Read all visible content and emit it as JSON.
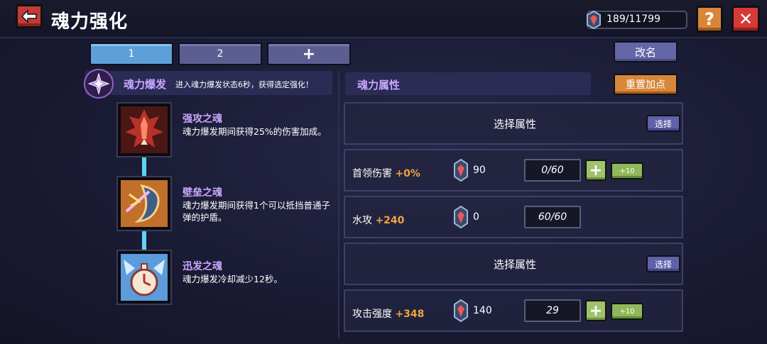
{
  "header": {
    "title": "魂力强化",
    "currency": "189/11799",
    "help_label": "?",
    "close_label": "✕"
  },
  "tabs": [
    {
      "label": "1",
      "active": true
    },
    {
      "label": "2",
      "active": false
    },
    {
      "label": "+",
      "active": false
    }
  ],
  "rename_label": "改名",
  "burst": {
    "name": "魂力爆发",
    "description": "进入魂力爆发状态6秒，获得选定强化！"
  },
  "skills": [
    {
      "name": "强攻之魂",
      "description": "魂力爆发期间获得25%的伤害加成。",
      "icon": "flame-soul-icon"
    },
    {
      "name": "壁垒之魂",
      "description": "魂力爆发期间获得1个可以抵挡普通子弹的护盾。",
      "icon": "shield-soul-icon"
    },
    {
      "name": "迅发之魂",
      "description": "魂力爆发冷却减少12秒。",
      "icon": "clock-soul-icon"
    }
  ],
  "attributes": {
    "title": "魂力属性",
    "reset_label": "重置加点",
    "rows": [
      {
        "type": "select",
        "label": "选择属性",
        "button": "选择"
      },
      {
        "type": "stat",
        "label": "首领伤害",
        "bonus": "+0%",
        "cost": "90",
        "value": "0/60",
        "show_plus": true,
        "plus10": "+10"
      },
      {
        "type": "stat",
        "label": "水攻",
        "bonus": "+240",
        "cost": "0",
        "value": "60/60",
        "show_plus": false
      },
      {
        "type": "select",
        "label": "选择属性",
        "button": "选择"
      },
      {
        "type": "stat",
        "label": "攻击强度",
        "bonus": "+348",
        "cost": "140",
        "value": "29",
        "show_plus": true,
        "plus10": "+10"
      }
    ]
  },
  "colors": {
    "accent_purple": "#c9a7ff",
    "bonus_orange": "#f1a33e",
    "tab_active": "#5e9fd9",
    "button_orange": "#d7873b",
    "button_green": "#9fc36a"
  }
}
